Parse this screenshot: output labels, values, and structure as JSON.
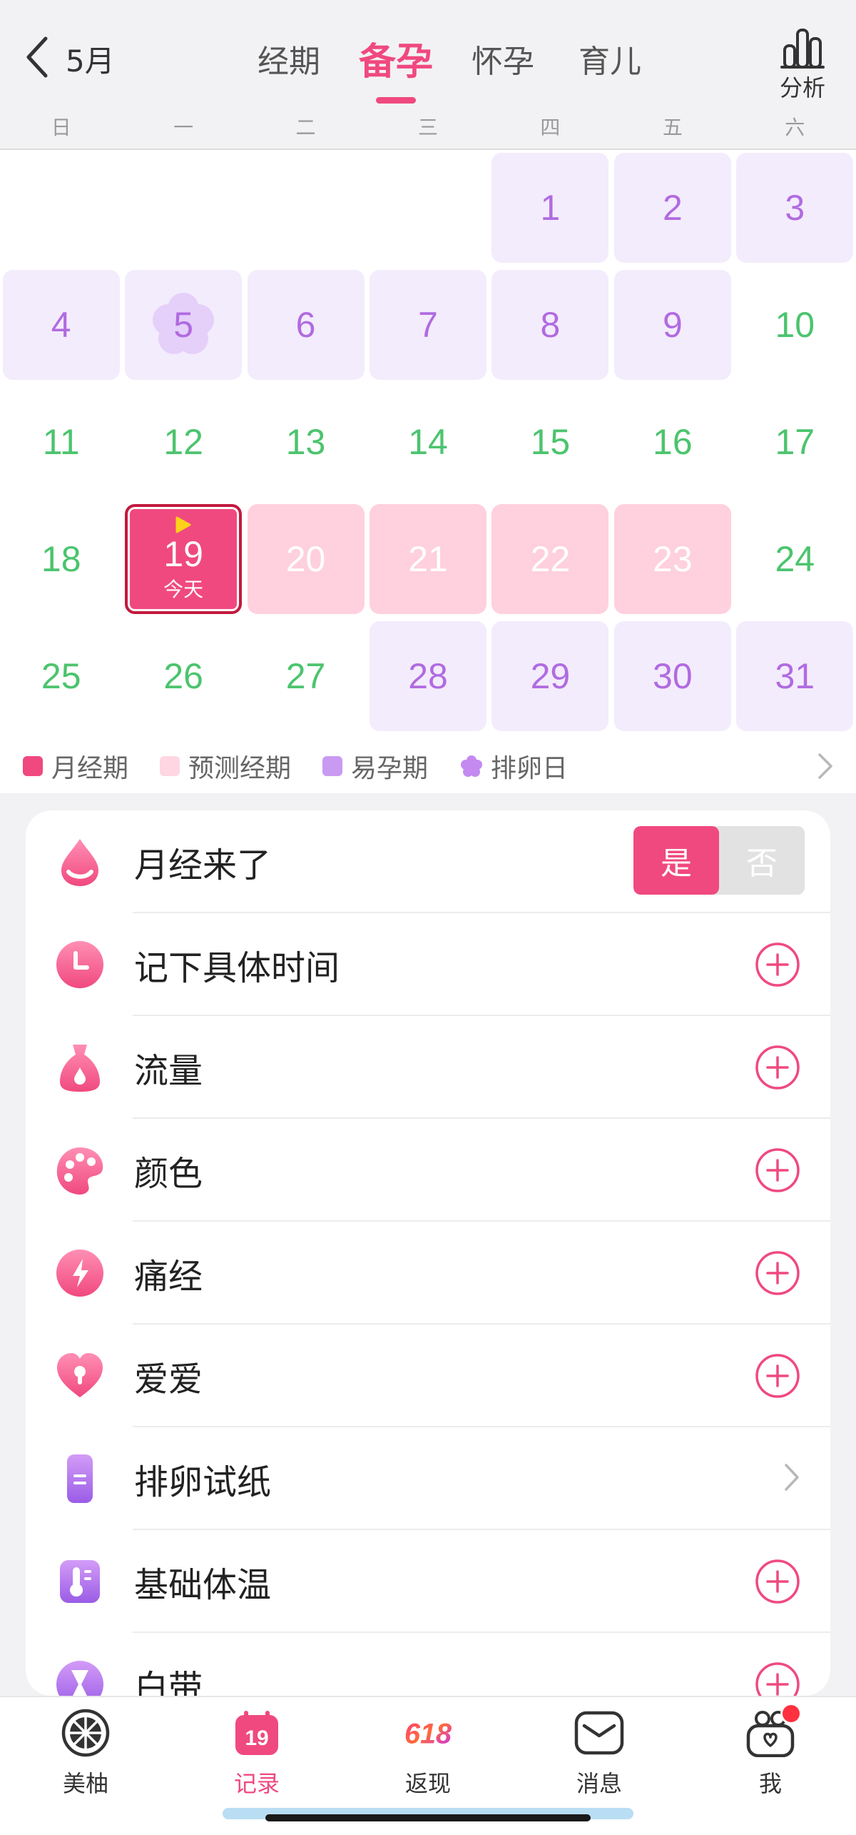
{
  "header": {
    "month": "5月",
    "tabs": [
      "经期",
      "备孕",
      "怀孕",
      "育儿"
    ],
    "active_tab": 1,
    "analysis_label": "分析"
  },
  "weekdays": [
    "日",
    "一",
    "二",
    "三",
    "四",
    "五",
    "六"
  ],
  "calendar": {
    "today_label": "今天",
    "days": [
      {
        "day": "1",
        "type": "fertile"
      },
      {
        "day": "2",
        "type": "fertile"
      },
      {
        "day": "3",
        "type": "fertile"
      },
      {
        "day": "4",
        "type": "fertile"
      },
      {
        "day": "5",
        "type": "ovulation"
      },
      {
        "day": "6",
        "type": "fertile"
      },
      {
        "day": "7",
        "type": "fertile"
      },
      {
        "day": "8",
        "type": "fertile"
      },
      {
        "day": "9",
        "type": "fertile"
      },
      {
        "day": "10",
        "type": "normal"
      },
      {
        "day": "11",
        "type": "normal"
      },
      {
        "day": "12",
        "type": "normal"
      },
      {
        "day": "13",
        "type": "normal"
      },
      {
        "day": "14",
        "type": "normal"
      },
      {
        "day": "15",
        "type": "normal"
      },
      {
        "day": "16",
        "type": "normal"
      },
      {
        "day": "17",
        "type": "normal"
      },
      {
        "day": "18",
        "type": "normal"
      },
      {
        "day": "19",
        "type": "today"
      },
      {
        "day": "20",
        "type": "predicted"
      },
      {
        "day": "21",
        "type": "predicted"
      },
      {
        "day": "22",
        "type": "predicted"
      },
      {
        "day": "23",
        "type": "predicted"
      },
      {
        "day": "24",
        "type": "normal"
      },
      {
        "day": "25",
        "type": "normal"
      },
      {
        "day": "26",
        "type": "normal"
      },
      {
        "day": "27",
        "type": "normal"
      },
      {
        "day": "28",
        "type": "fertile"
      },
      {
        "day": "29",
        "type": "fertile"
      },
      {
        "day": "30",
        "type": "fertile"
      },
      {
        "day": "31",
        "type": "fertile"
      }
    ]
  },
  "legend": {
    "period": "月经期",
    "predicted": "预测经期",
    "fertile": "易孕期",
    "ovulation": "排卵日"
  },
  "colors": {
    "accent": "#f0497f",
    "period": "#f0497f",
    "predicted": "#ffd0de",
    "fertile": "#c99af2",
    "ovulation": "#c48af0",
    "normal_day": "#4cc46e"
  },
  "records": {
    "period_came": {
      "label": "月经来了",
      "yes": "是",
      "no": "否",
      "icon": "drop-icon"
    },
    "items": [
      {
        "label": "记下具体时间",
        "icon": "clock-icon",
        "action": "add"
      },
      {
        "label": "流量",
        "icon": "bag-icon",
        "action": "add"
      },
      {
        "label": "颜色",
        "icon": "palette-icon",
        "action": "add"
      },
      {
        "label": "痛经",
        "icon": "lightning-icon",
        "action": "add"
      },
      {
        "label": "爱爱",
        "icon": "heart-icon",
        "action": "add"
      },
      {
        "label": "排卵试纸",
        "icon": "test-strip-icon",
        "action": "chevron"
      },
      {
        "label": "基础体温",
        "icon": "thermometer-icon",
        "action": "add"
      },
      {
        "label": "白带",
        "icon": "hourglass-icon",
        "action": "add"
      }
    ]
  },
  "bottom_nav": [
    {
      "label": "美柚",
      "icon": "pomelo-icon"
    },
    {
      "label": "记录",
      "icon": "calendar-19-icon",
      "calendar_day": "19"
    },
    {
      "label": "返现",
      "icon": "618-icon",
      "promo": "618"
    },
    {
      "label": "消息",
      "icon": "message-icon"
    },
    {
      "label": "我",
      "icon": "profile-icon"
    }
  ],
  "bottom_nav_active": 1
}
